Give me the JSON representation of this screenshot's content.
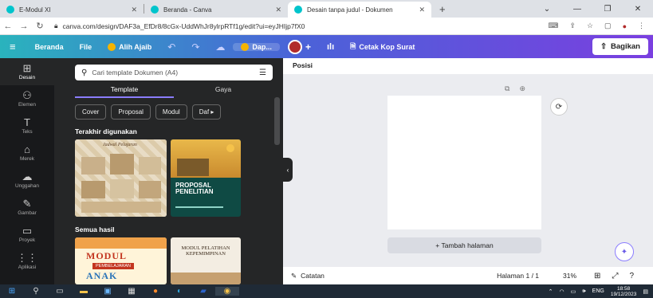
{
  "browser": {
    "tabs": [
      {
        "title": "E-Modul XI",
        "active": false
      },
      {
        "title": "Beranda - Canva",
        "active": false
      },
      {
        "title": "Desain tanpa judul - Dokumen",
        "active": true
      }
    ],
    "url": "canva.com/design/DAF3a_EfDr8/8cGx-UddWhJr8ylrpRTf1g/edit?ui=eyJHIjp7fX0"
  },
  "topbar": {
    "home": "Beranda",
    "file": "File",
    "magic": "Alih Ajaib",
    "project_name": "Dap...",
    "print": "Cetak Kop Surat",
    "share": "Bagikan"
  },
  "rail": [
    {
      "label": "Desain",
      "icon": "layout-icon",
      "glyph": "⊞",
      "active": true
    },
    {
      "label": "Elemen",
      "icon": "shapes-icon",
      "glyph": "⚇",
      "active": false
    },
    {
      "label": "Teks",
      "icon": "text-icon",
      "glyph": "T",
      "active": false
    },
    {
      "label": "Merek",
      "icon": "brand-icon",
      "glyph": "⌂",
      "active": false
    },
    {
      "label": "Unggahan",
      "icon": "upload-icon",
      "glyph": "☁",
      "active": false
    },
    {
      "label": "Gambar",
      "icon": "draw-icon",
      "glyph": "✎",
      "active": false
    },
    {
      "label": "Proyek",
      "icon": "folder-icon",
      "glyph": "▭",
      "active": false
    },
    {
      "label": "Aplikasi",
      "icon": "apps-icon",
      "glyph": "⋮⋮",
      "active": false
    }
  ],
  "panel": {
    "search_placeholder": "Cari template Dokumen (A4)",
    "tab_template": "Template",
    "tab_style": "Gaya",
    "chips": [
      "Cover",
      "Proposal",
      "Modul",
      "Daf"
    ],
    "recent_heading": "Terakhir digunakan",
    "all_heading": "Semua hasil",
    "thumb_recent_1_title": "Jadwal Pelajaran",
    "thumb_recent_2_title": "PROPOSAL PENELITIAN",
    "thumb_all_1_title": "MODUL",
    "thumb_all_1_sub": "PEMBELAJARAN",
    "thumb_all_1_word": "ANAK",
    "thumb_all_2_title": "MODUL PELATIHAN KEPEMIMPINAN"
  },
  "canvas": {
    "position_label": "Posisi",
    "add_page": "+ Tambah halaman"
  },
  "footer": {
    "notes": "Catatan",
    "page": "Halaman 1 / 1",
    "zoom": "31%"
  },
  "taskbar": {
    "lang": "ENG",
    "time": "18:58",
    "date": "19/12/2023"
  }
}
